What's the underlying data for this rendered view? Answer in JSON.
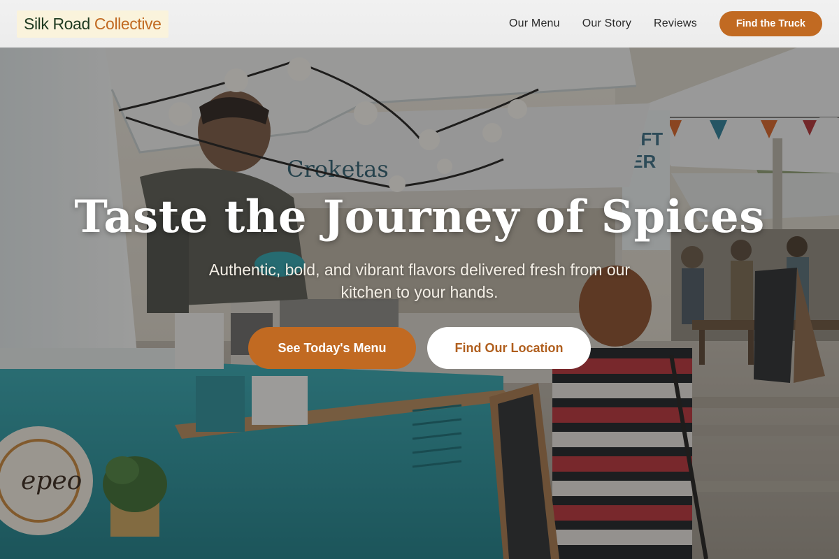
{
  "brand": {
    "name_part1": "Silk Road",
    "name_part2": "Collective"
  },
  "nav": {
    "links": [
      "Our Menu",
      "Our Story",
      "Reviews"
    ],
    "cta": "Find the Truck"
  },
  "hero": {
    "title": "Taste the Journey of Spices",
    "subtitle": "Authentic, bold, and vibrant flavors delivered fresh from our kitchen to your hands.",
    "primary_button": "See Today's Menu",
    "secondary_button": "Find Our Location",
    "photo": {
      "truck_sign": "Croketas",
      "stall_sign_line1": "CRAFT",
      "stall_sign_line2": "BEER",
      "logo_sticker": "epeo"
    }
  },
  "colors": {
    "accent": "#c16a22",
    "header_bg": "#efefef",
    "truck_teal": "#2a9aa6"
  }
}
